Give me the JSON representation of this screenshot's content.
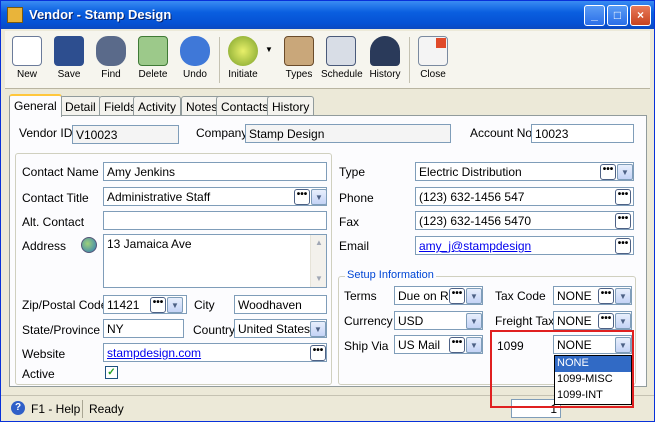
{
  "window": {
    "title": "Vendor - Stamp Design",
    "min": "_",
    "max": "□",
    "close": "×"
  },
  "toolbar": [
    {
      "label": "New",
      "icon": "new-icon"
    },
    {
      "label": "Save",
      "icon": "save-icon"
    },
    {
      "label": "Find",
      "icon": "find-icon"
    },
    {
      "label": "Delete",
      "icon": "delete-icon"
    },
    {
      "label": "Undo",
      "icon": "undo-icon"
    },
    {
      "label": "Initiate",
      "icon": "initiate-icon"
    },
    {
      "label": "Types",
      "icon": "types-icon"
    },
    {
      "label": "Schedule",
      "icon": "schedule-icon"
    },
    {
      "label": "History",
      "icon": "history-icon"
    },
    {
      "label": "Close",
      "icon": "close-icon"
    }
  ],
  "tabs": [
    "General",
    "Detail",
    "Fields",
    "Activity",
    "Notes",
    "Contacts",
    "History"
  ],
  "form": {
    "vendor_id_label": "Vendor ID",
    "vendor_id": "V10023",
    "company_label": "Company",
    "company": "Stamp Design",
    "account_no_label": "Account No",
    "account_no": "10023",
    "contact_name_label": "Contact Name",
    "contact_name": "Amy Jenkins",
    "contact_title_label": "Contact Title",
    "contact_title": "Administrative Staff",
    "alt_contact_label": "Alt. Contact",
    "alt_contact": "",
    "address_label": "Address",
    "address": "13 Jamaica Ave",
    "zip_label": "Zip/Postal Code",
    "zip": "11421",
    "city_label": "City",
    "city": "Woodhaven",
    "state_label": "State/Province",
    "state": "NY",
    "country_label": "Country",
    "country": "United States",
    "website_label": "Website",
    "website": "stampdesign.com",
    "active_label": "Active",
    "active_check": "✓",
    "type_label": "Type",
    "type": "Electric Distribution",
    "phone_label": "Phone",
    "phone": "(123) 632-1456 547",
    "fax_label": "Fax",
    "fax": "(123) 632-1456 5470",
    "email_label": "Email",
    "email": "amy_j@stampdesign",
    "setup_title": "Setup Information",
    "terms_label": "Terms",
    "terms": "Due on R",
    "tax_code_label": "Tax Code",
    "tax_code": "NONE",
    "currency_label": "Currency",
    "currency": "USD",
    "freight_tax_label": "Freight Tax",
    "freight_tax": "NONE",
    "ship_via_label": "Ship Via",
    "ship_via": "US Mail",
    "f1099_label": "1099",
    "f1099": "NONE",
    "f1099_options": [
      "NONE",
      "1099-MISC",
      "1099-INT"
    ]
  },
  "status": {
    "help": "F1 - Help",
    "state": "Ready",
    "page": "1"
  },
  "glyphs": {
    "dd": "▼",
    "ell": "•••",
    "up": "▲",
    "down": "▼"
  }
}
